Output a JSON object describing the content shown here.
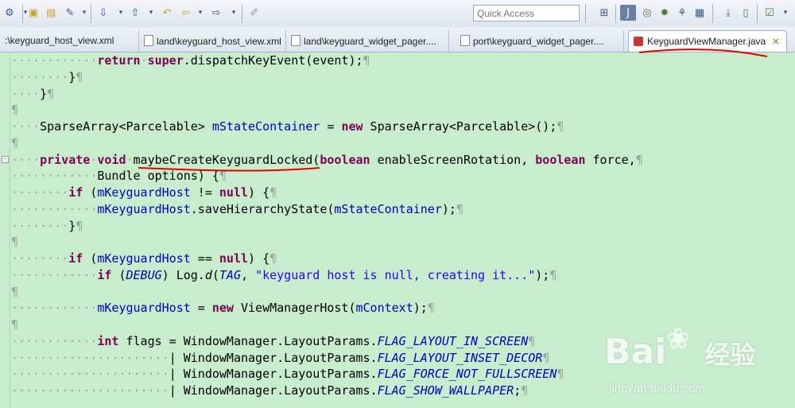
{
  "toolbar": {
    "quick_access_placeholder": "Quick Access",
    "icons": [
      "gear-icon",
      "open-folder-icon",
      "folder-icon",
      "brush-icon",
      "arrow-down-icon",
      "arrow-up-icon",
      "back-icon",
      "forward-icon",
      "pin-icon",
      "plus-icon",
      "java-perspective-icon",
      "debug-perspective-icon",
      "bug-icon",
      "ddms-icon",
      "download-icon",
      "device-icon",
      "check-icon"
    ]
  },
  "tabs": [
    {
      "label": ":\\keyguard_host_view.xml"
    },
    {
      "label": "land\\keyguard_host_view.xml"
    },
    {
      "label": "land\\keyguard_widget_pager...."
    },
    {
      "label": "port\\keyguard_widget_pager...."
    },
    {
      "label": "KeyguardViewManager.java",
      "active": true
    }
  ],
  "code": {
    "l1_a": "return",
    "l1_b": "super",
    "l1_c": ".dispatchKeyEvent(event);",
    "l2": "}",
    "l3": "}",
    "l5_a": "SparseArray<Parcelable> ",
    "l5_b": "mStateContainer",
    "l5_c": " = ",
    "l5_d": "new",
    "l5_e": " SparseArray<Parcelable>();",
    "l7_a": "private",
    "l7_b": "void",
    "l7_c": "maybeCreateKeyguardLocked(",
    "l7_d": "boolean",
    "l7_e": " enableScreenRotation, ",
    "l7_f": "boolean",
    "l7_g": " force,",
    "l8": "Bundle options) {",
    "l9_a": "if",
    "l9_b": " (",
    "l9_c": "mKeyguardHost",
    "l9_d": " != ",
    "l9_e": "null",
    "l9_f": ") {",
    "l10_a": "mKeyguardHost",
    "l10_b": ".saveHierarchyState(",
    "l10_c": "mStateContainer",
    "l10_d": ");",
    "l11": "}",
    "l13_a": "if",
    "l13_b": " (",
    "l13_c": "mKeyguardHost",
    "l13_d": " == ",
    "l13_e": "null",
    "l13_f": ") {",
    "l14_a": "if",
    "l14_b": " (",
    "l14_c": "DEBUG",
    "l14_d": ") Log.",
    "l14_e": "d",
    "l14_f": "(",
    "l14_g": "TAG",
    "l14_h": ", ",
    "l14_i": "\"keyguard host is null, creating it...\"",
    "l14_j": ");",
    "l16_a": "mKeyguardHost",
    "l16_b": " = ",
    "l16_c": "new",
    "l16_d": " ViewManagerHost(",
    "l16_e": "mContext",
    "l16_f": ");",
    "l18_a": "int",
    "l18_b": " flags = WindowManager.LayoutParams.",
    "l18_c": "FLAG_LAYOUT_IN_SCREEN",
    "l19_a": "| WindowManager.LayoutParams.",
    "l19_b": "FLAG_LAYOUT_INSET_DECOR",
    "l20_a": "| WindowManager.LayoutParams.",
    "l20_b": "FLAG_FORCE_NOT_FULLSCREEN",
    "l21_a": "| WindowManager.LayoutParams.",
    "l21_b": "FLAG_SHOW_WALLPAPER",
    "l21_c": ";"
  },
  "watermark": {
    "brand": "Bai",
    "brand2": "经验",
    "url": "jingyan.baidu.com"
  },
  "colors": {
    "editor_bg": "#c7edcc",
    "keyword": "#7f0055",
    "field": "#0000c0",
    "string": "#2a00ff",
    "annotation": "#e00000"
  }
}
